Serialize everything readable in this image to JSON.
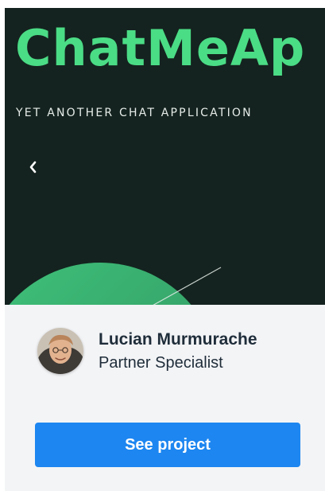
{
  "hero": {
    "title": "ChatMeAp",
    "subtitle": "YET ANOTHER CHAT APPLICATION",
    "nav_icon": "chevron-left-icon",
    "colors": {
      "background": "#14231f",
      "accent": "#4bdc86"
    }
  },
  "author": {
    "name": "Lucian Murmurache",
    "role": "Partner Specialist"
  },
  "actions": {
    "primary_label": "See project",
    "primary_color": "#1d86f0"
  }
}
